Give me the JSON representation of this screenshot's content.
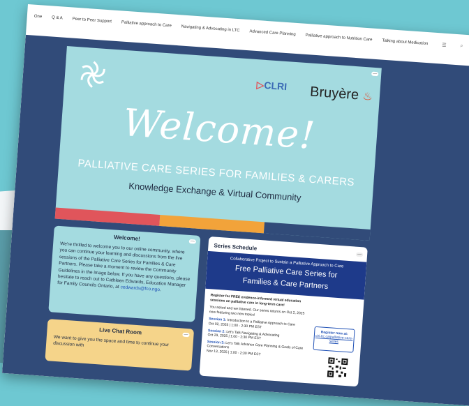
{
  "nav": {
    "items": [
      "One",
      "Q & A",
      "Peer to Peer Support",
      "Palliative approach to Care",
      "Navigating & Advocating in LTC",
      "Advanced Care Planning",
      "Palliative approach to Nutrition Care",
      "Talking about Medication"
    ]
  },
  "hero": {
    "title": "Welcome!",
    "subtitle": "PALLIATIVE CARE SERIES FOR FAMILIES & CARERS",
    "tagline": "Knowledge Exchange & Virtual Community",
    "logo_clri": "CLRI",
    "logo_bruyere": "Bruyère",
    "stripe_colors": [
      "#e0555b",
      "#f2a33a",
      "#314b79"
    ]
  },
  "welcome_card": {
    "title": "Welcome!",
    "body": "We're thrilled to welcome you to our online community, where you can continue your learning and discussions from the live sessions of the Palliative Care Series for Families & Care Partners. Please take a moment to review the Community Guidelines in the image below. If you have any questions, please hesitate to reach out to Cathleen Edwards, Education Manager for Family Councils Ontario, at",
    "email": "cedwards@fco.ngo",
    "end": "."
  },
  "chat_card": {
    "title": "Live Chat Room",
    "body": "We want to give you the space and time to continue your discussion with"
  },
  "schedule": {
    "title": "Series Schedule",
    "banner_small": "Collaborative Project to Sustain a Palliative Approach to Care",
    "banner_big_1": "Free Palliative Care Series for",
    "banner_big_2": "Families & Care Partners",
    "register": "Register for FREE evidence-informed virtual education sessions on palliative care in long-term care!",
    "intro": "You asked and we listened. Our series returns on Oct 2, 2025 now featuring two new topics!",
    "s1_label": "Session 1:",
    "s1_title": "Introduction to a Palliative Approach to Care",
    "s1_date": "Oct 02, 2025 | 1:00 - 2:30 PM EST",
    "s2_label": "Session 2:",
    "s2_title": "Let's Talk Navigating & Advocating",
    "s2_date": "Oct 29, 2025 | 1:00 - 2:30 PM EST",
    "s3_label": "Session 3:",
    "s3_title": "Let's Talk Advance Care Planning & Goals of Care Conversations",
    "s3_date": "Nov 13, 2025 | 1:00 - 2:30 PM EST",
    "reg_box_1": "Register now at:",
    "reg_box_2": "clri-ltc.ca/palliative-care-series"
  }
}
